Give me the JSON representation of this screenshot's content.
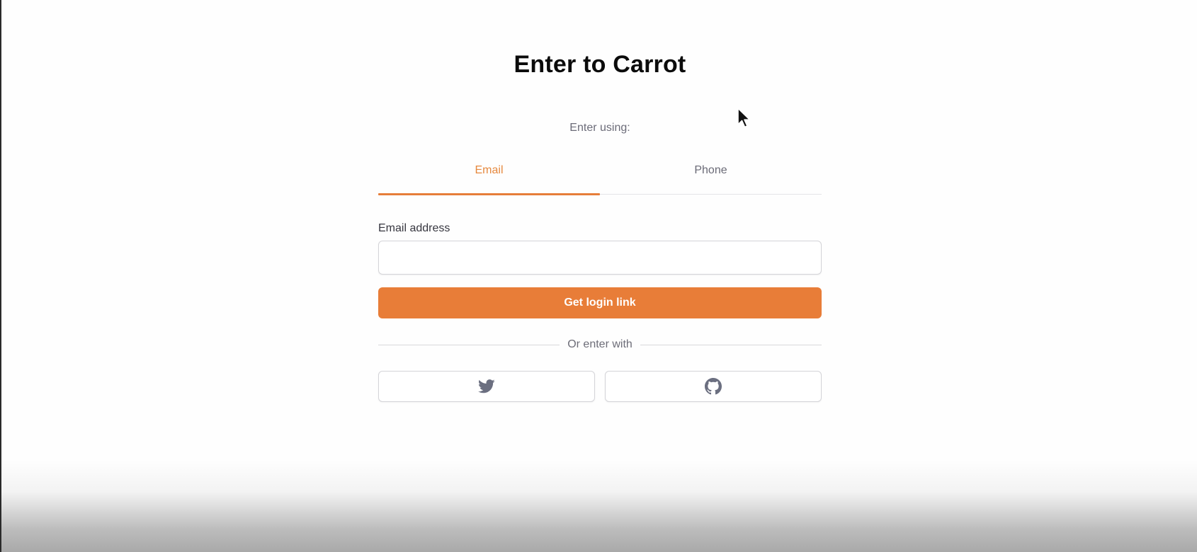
{
  "page": {
    "title": "Enter to Carrot",
    "enter_using": "Enter using:"
  },
  "tabs": [
    {
      "label": "Email",
      "active": true
    },
    {
      "label": "Phone",
      "active": false
    }
  ],
  "form": {
    "email_label": "Email address",
    "email_value": "",
    "email_placeholder": "",
    "submit_label": "Get login link"
  },
  "divider": {
    "text": "Or enter with"
  },
  "social": [
    {
      "provider": "Twitter",
      "icon": "twitter-icon"
    },
    {
      "provider": "GitHub",
      "icon": "github-icon"
    }
  ],
  "colors": {
    "accent": "#e87d38",
    "active_tab_text": "#e6893f",
    "muted_text": "#6b6b78",
    "icon_gray": "#6b6f80"
  }
}
